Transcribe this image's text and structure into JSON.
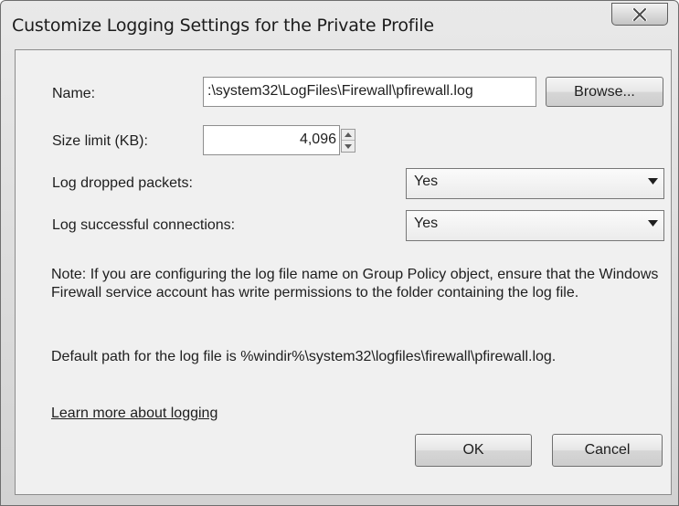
{
  "window": {
    "title": "Customize Logging Settings for the Private Profile",
    "close_icon": "close-icon"
  },
  "form": {
    "name_label": "Name:",
    "name_value": ":\\system32\\LogFiles\\Firewall\\pfirewall.log",
    "browse_label": "Browse...",
    "size_label": "Size limit (KB):",
    "size_value": "4,096",
    "dropped_label": "Log dropped packets:",
    "dropped_value": "Yes",
    "success_label": "Log successful connections:",
    "success_value": "Yes"
  },
  "note": {
    "text": "Note: If you are configuring the log file name on Group Policy object, ensure that the Windows Firewall service account has write permissions to the folder containing the log file.",
    "default_path": "Default path for the log file is %windir%\\system32\\logfiles\\firewall\\pfirewall.log."
  },
  "link": {
    "label": "Learn more about logging"
  },
  "buttons": {
    "ok": "OK",
    "cancel": "Cancel"
  }
}
